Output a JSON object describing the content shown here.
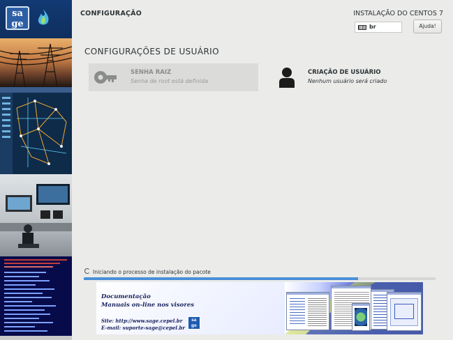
{
  "sidebar": {
    "logo_text": "sa ge"
  },
  "header": {
    "title": "CONFIGURAÇÃO",
    "install_title": "INSTALAÇÃO DO CENTOS 7",
    "keyboard_layout": "br",
    "help_label": "Ajuda!"
  },
  "section": {
    "title": "CONFIGURAÇÕES DE USUÁRIO"
  },
  "spokes": {
    "root": {
      "title": "SENHA RAIZ",
      "status": "Senha de root está definida",
      "icon": "key-icon"
    },
    "user": {
      "title": "CRIAÇÃO DE USUÁRIO",
      "status": "Nenhum usuário será criado",
      "icon": "user-icon"
    }
  },
  "progress": {
    "label": "Iniciando o processo de instalação do pacote",
    "fraction": 0.78
  },
  "banner": {
    "documentation": "Documentação",
    "manuals": "Manuais on-line nos visores",
    "site": "Site: http://www.sage.cepel.br",
    "email": "E-mail: suporte-sage@cepel.br",
    "logo_text": "sa ge"
  },
  "colors": {
    "background": "#ebebea",
    "progress": "#4a90d9",
    "text": "#2e3436"
  }
}
